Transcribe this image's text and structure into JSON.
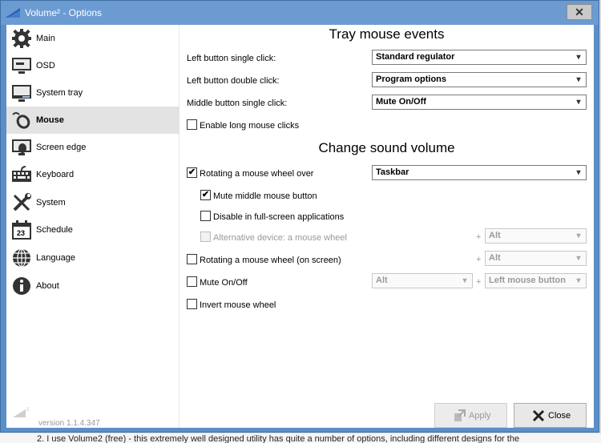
{
  "window": {
    "title": "Volume² - Options"
  },
  "sidebar": {
    "items": [
      {
        "label": "Main",
        "icon": "gear-icon"
      },
      {
        "label": "OSD",
        "icon": "monitor-icon"
      },
      {
        "label": "System tray",
        "icon": "system-tray-icon"
      },
      {
        "label": "Mouse",
        "icon": "mouse-icon",
        "selected": true
      },
      {
        "label": "Screen edge",
        "icon": "screen-edge-icon"
      },
      {
        "label": "Keyboard",
        "icon": "keyboard-icon"
      },
      {
        "label": "System",
        "icon": "tools-icon"
      },
      {
        "label": "Schedule",
        "icon": "calendar-icon"
      },
      {
        "label": "Language",
        "icon": "globe-icon"
      },
      {
        "label": "About",
        "icon": "info-icon"
      }
    ],
    "calendar_day": "23",
    "version": "version 1.1.4.347"
  },
  "tray": {
    "title": "Tray mouse events",
    "left_single_label": "Left button single click:",
    "left_single_value": "Standard regulator",
    "left_double_label": "Left button double click:",
    "left_double_value": "Program options",
    "middle_single_label": "Middle button single click:",
    "middle_single_value": "Mute On/Off",
    "long_clicks_label": "Enable long mouse clicks",
    "long_clicks_checked": false
  },
  "volume": {
    "title": "Change sound volume",
    "wheel_over_label": "Rotating a mouse wheel over",
    "wheel_over_checked": true,
    "wheel_over_value": "Taskbar",
    "mute_middle_label": "Mute middle mouse button",
    "mute_middle_checked": true,
    "disable_fullscreen_label": "Disable in full-screen applications",
    "disable_fullscreen_checked": false,
    "alt_device_label": "Alternative device: a mouse wheel",
    "alt_device_checked": false,
    "alt_device_modifier": "Alt",
    "wheel_screen_label": "Rotating a mouse wheel (on screen)",
    "wheel_screen_checked": false,
    "wheel_screen_modifier": "Alt",
    "mute_label": "Mute On/Off",
    "mute_checked": false,
    "mute_modifier": "Alt",
    "mute_button": "Left mouse button",
    "invert_label": "Invert mouse wheel",
    "invert_checked": false
  },
  "buttons": {
    "apply": "Apply",
    "close": "Close"
  },
  "symbols": {
    "plus": "+",
    "check": "✔",
    "caret": "▾",
    "close_x": "✕"
  },
  "background_text": "2. I use Volume2 (free) - this extremely well designed utility has quite a number of options, including different designs for the"
}
